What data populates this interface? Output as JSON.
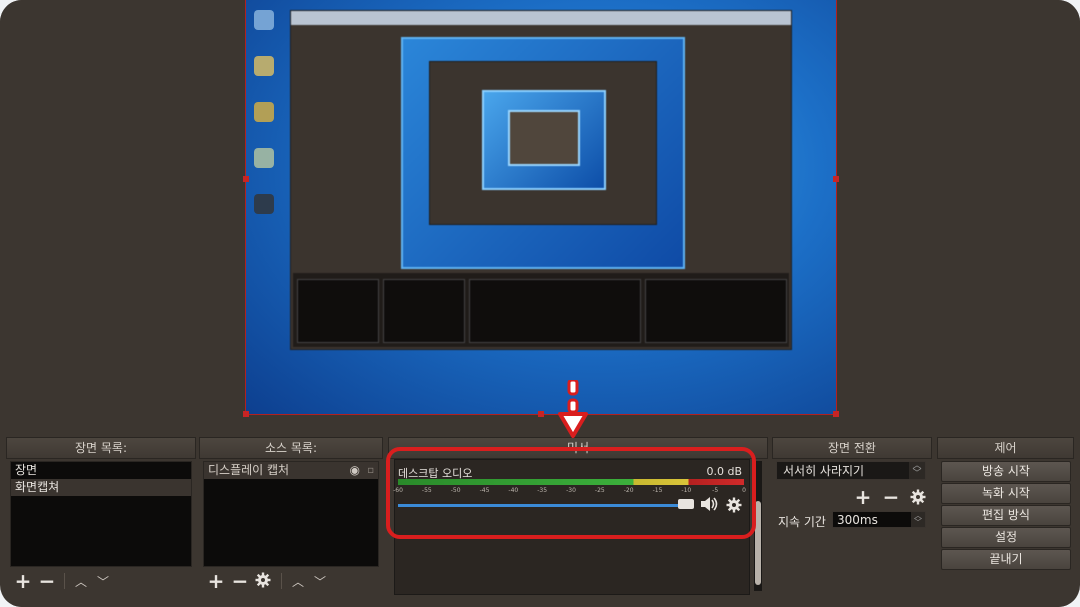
{
  "panels": {
    "scenes": {
      "title": "장면 목록:",
      "items": [
        "장면",
        "화면캡쳐"
      ]
    },
    "sources": {
      "title": "소스 목록:",
      "items": [
        "디스플레이 캡처"
      ]
    },
    "mixer": {
      "title": "믹서",
      "track_name": "데스크탑 오디오",
      "level_db": "0.0 dB",
      "meter_ticks": [
        "-60",
        "-55",
        "-50",
        "-45",
        "-40",
        "-35",
        "-30",
        "-25",
        "-20",
        "-15",
        "-10",
        "-5",
        "0"
      ],
      "volume_level": 1.0
    },
    "transitions": {
      "title": "장면 전환",
      "selected": "서서히 사라지기",
      "duration_label": "지속 기간",
      "duration_value": "300ms"
    },
    "controls": {
      "title": "제어",
      "buttons": [
        "방송 시작",
        "녹화 시작",
        "편집 방식",
        "설정",
        "끝내기"
      ]
    }
  },
  "colors": {
    "highlight": "#d91e1e",
    "background": "#3c3630",
    "meter_green": "#3cb03c",
    "meter_yellow": "#d9c43a",
    "meter_red": "#d02a2a",
    "volume_blue": "#3b8bd8"
  },
  "icons": {
    "add": "plus-icon",
    "remove": "minus-icon",
    "settings": "gear-icon",
    "up": "chevron-up-icon",
    "down": "chevron-down-icon",
    "visibility": "eye-icon",
    "lock": "lock-icon",
    "speaker": "speaker-icon"
  }
}
